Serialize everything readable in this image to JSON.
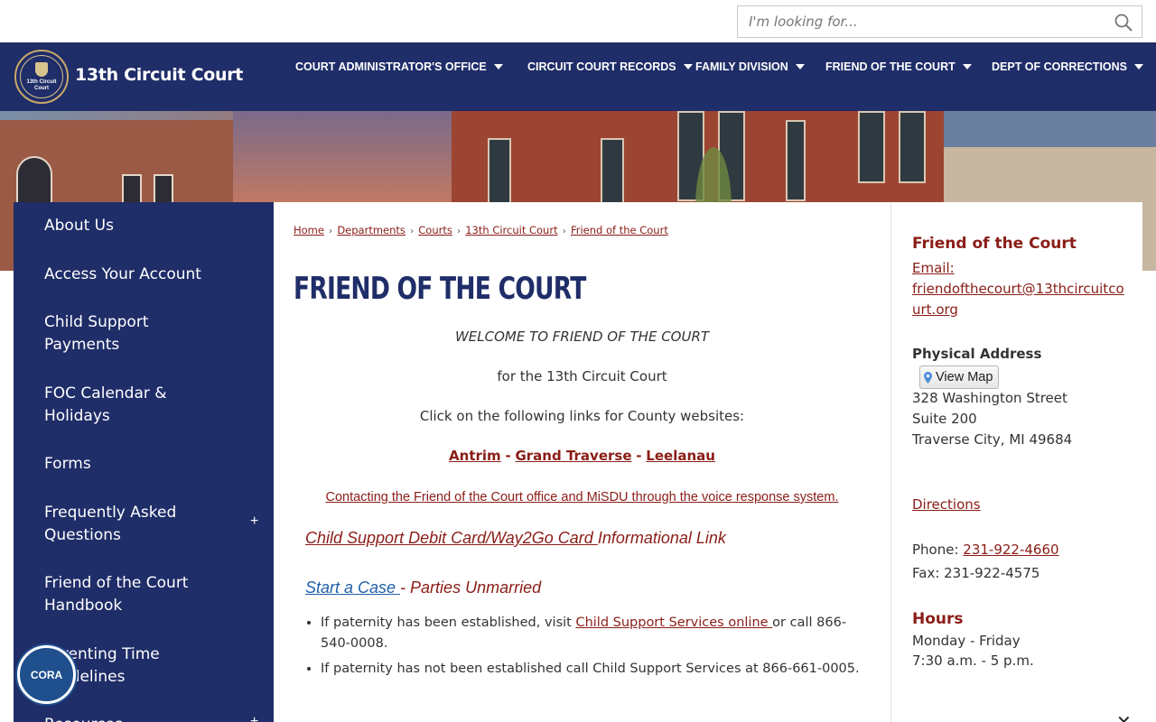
{
  "search": {
    "placeholder": "I'm looking for..."
  },
  "site": {
    "title": "13th Circuit Court",
    "seal_text": "13th Circuit Court"
  },
  "nav": {
    "items": [
      {
        "label": "COURT ADMINISTRATOR'S OFFICE"
      },
      {
        "label": "CIRCUIT COURT RECORDS"
      },
      {
        "label": "FAMILY DIVISION"
      },
      {
        "label": "FRIEND OF THE COURT"
      },
      {
        "label": "DEPT OF CORRECTIONS"
      }
    ]
  },
  "sidebar": {
    "items": [
      {
        "label": "About Us"
      },
      {
        "label": "Access Your Account"
      },
      {
        "label": "Child Support Payments"
      },
      {
        "label": "FOC Calendar & Holidays"
      },
      {
        "label": "Forms"
      },
      {
        "label": "Frequently Asked Questions",
        "expander": "+"
      },
      {
        "label": "Friend of the Court Handbook"
      },
      {
        "label": "Parenting Time Guidelines"
      },
      {
        "label": "Resources",
        "expander": "+"
      }
    ]
  },
  "breadcrumb": [
    "Home",
    "Departments",
    "Courts",
    "13th Circuit Court",
    "Friend of the Court"
  ],
  "main": {
    "title": "FRIEND OF THE COURT",
    "welcome": "WELCOME TO FRIEND OF THE COURT",
    "for_line": "for the 13th Circuit Court",
    "click_line": "Click on the following links for County websites:",
    "counties": [
      "Antrim",
      "Grand Traverse",
      "Leelanau"
    ],
    "county_sep": "-",
    "voice_link": "Contacting the Friend of the Court office and MiSDU through the voice response system.",
    "debit_link": "Child Support Debit Card/Way2Go Card ",
    "debit_suffix": "Informational Link",
    "start_case_link": "Start a Case ",
    "start_case_suffix": "- Parties Unmarried",
    "bullets": [
      {
        "pre": "If paternity has been established, visit ",
        "link": "Child Support Services online ",
        "post": "or call 866-540-0008."
      },
      {
        "pre": "If paternity has not been established call Child Support Services at 866-661-0005.",
        "link": "",
        "post": ""
      }
    ]
  },
  "right": {
    "heading": "Friend of the Court",
    "email_label": "Email:",
    "email": "friendofthecourt@13thcircuitcourt.org",
    "address_label": "Physical Address",
    "view_map": "View Map",
    "address_lines": [
      "328 Washington Street",
      "Suite 200",
      "Traverse City, MI 49684"
    ],
    "directions": "Directions",
    "phone_label": "Phone: ",
    "phone": "231-922-4660",
    "fax": "Fax: 231-922-4575",
    "hours_heading": "Hours",
    "hours_lines": [
      "Monday - Friday",
      "7:30 a.m. - 5 p.m."
    ]
  },
  "cora": {
    "label": "CORA"
  },
  "colors": {
    "navy": "#1f2d68",
    "maroon": "#8a1d17",
    "link_blue": "#1f5fa8"
  }
}
